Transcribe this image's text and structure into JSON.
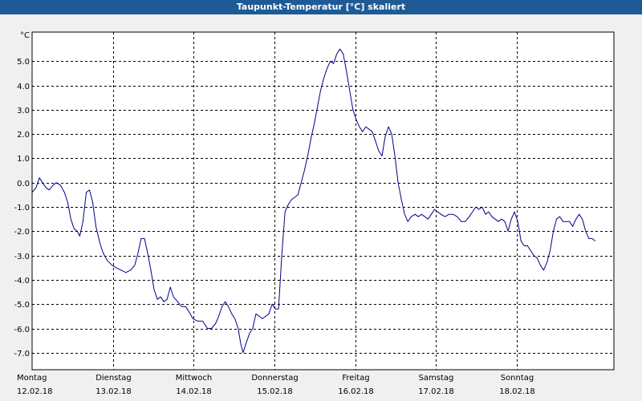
{
  "window": {
    "title": "Taupunkt-Temperatur [°C] skaliert"
  },
  "chart_data": {
    "type": "line",
    "title": "Taupunkt-Temperatur [°C] skaliert",
    "y_unit": "°C",
    "ylim": [
      -7.7,
      6.2
    ],
    "xlim": [
      0,
      7.2
    ],
    "y_ticks": [
      5.0,
      4.0,
      3.0,
      2.0,
      1.0,
      0.0,
      -1.0,
      -2.0,
      -3.0,
      -4.0,
      -5.0,
      -6.0,
      -7.0
    ],
    "y_tick_labels": [
      "5.0",
      "4.0",
      "3.0",
      "2.0",
      "1.0",
      "0.0",
      "-1.0",
      "-2.0",
      "-3.0",
      "-4.0",
      "-5.0",
      "-6.0",
      "-7.0"
    ],
    "x_ticks": [
      {
        "day": "Montag",
        "date": "12.02.18"
      },
      {
        "day": "Dienstag",
        "date": "13.02.18"
      },
      {
        "day": "Mittwoch",
        "date": "14.02.18"
      },
      {
        "day": "Donnerstag",
        "date": "15.02.18"
      },
      {
        "day": "Freitag",
        "date": "16.02.18"
      },
      {
        "day": "Samstag",
        "date": "17.02.18"
      },
      {
        "day": "Sonntag",
        "date": "18.02.18"
      }
    ],
    "grid": true,
    "line_color": "#00008b",
    "series": [
      {
        "points": [
          [
            0.0,
            -0.4
          ],
          [
            0.05,
            -0.2
          ],
          [
            0.09,
            0.2
          ],
          [
            0.13,
            0.0
          ],
          [
            0.17,
            -0.2
          ],
          [
            0.21,
            -0.3
          ],
          [
            0.26,
            -0.1
          ],
          [
            0.3,
            0.0
          ],
          [
            0.35,
            -0.1
          ],
          [
            0.4,
            -0.4
          ],
          [
            0.44,
            -0.8
          ],
          [
            0.48,
            -1.5
          ],
          [
            0.52,
            -1.9
          ],
          [
            0.56,
            -2.0
          ],
          [
            0.59,
            -2.2
          ],
          [
            0.63,
            -1.6
          ],
          [
            0.67,
            -0.4
          ],
          [
            0.71,
            -0.3
          ],
          [
            0.75,
            -0.8
          ],
          [
            0.79,
            -1.8
          ],
          [
            0.84,
            -2.5
          ],
          [
            0.88,
            -2.9
          ],
          [
            0.93,
            -3.2
          ],
          [
            0.99,
            -3.4
          ],
          [
            1.04,
            -3.5
          ],
          [
            1.1,
            -3.6
          ],
          [
            1.16,
            -3.7
          ],
          [
            1.22,
            -3.6
          ],
          [
            1.27,
            -3.4
          ],
          [
            1.31,
            -2.9
          ],
          [
            1.35,
            -2.3
          ],
          [
            1.39,
            -2.3
          ],
          [
            1.43,
            -2.9
          ],
          [
            1.47,
            -3.6
          ],
          [
            1.51,
            -4.4
          ],
          [
            1.55,
            -4.8
          ],
          [
            1.59,
            -4.7
          ],
          [
            1.63,
            -4.9
          ],
          [
            1.67,
            -4.8
          ],
          [
            1.71,
            -4.3
          ],
          [
            1.75,
            -4.7
          ],
          [
            1.8,
            -4.9
          ],
          [
            1.85,
            -5.1
          ],
          [
            1.9,
            -5.1
          ],
          [
            1.94,
            -5.3
          ],
          [
            1.99,
            -5.6
          ],
          [
            2.05,
            -5.7
          ],
          [
            2.11,
            -5.7
          ],
          [
            2.17,
            -6.0
          ],
          [
            2.22,
            -6.0
          ],
          [
            2.27,
            -5.8
          ],
          [
            2.31,
            -5.5
          ],
          [
            2.35,
            -5.1
          ],
          [
            2.39,
            -4.9
          ],
          [
            2.43,
            -5.1
          ],
          [
            2.47,
            -5.4
          ],
          [
            2.51,
            -5.6
          ],
          [
            2.55,
            -6.0
          ],
          [
            2.58,
            -6.6
          ],
          [
            2.61,
            -7.0
          ],
          [
            2.65,
            -6.6
          ],
          [
            2.69,
            -6.2
          ],
          [
            2.73,
            -6.0
          ],
          [
            2.77,
            -5.4
          ],
          [
            2.81,
            -5.5
          ],
          [
            2.85,
            -5.6
          ],
          [
            2.89,
            -5.5
          ],
          [
            2.93,
            -5.4
          ],
          [
            2.97,
            -5.0
          ],
          [
            3.01,
            -5.2
          ],
          [
            3.05,
            -5.2
          ],
          [
            3.09,
            -3.0
          ],
          [
            3.13,
            -1.2
          ],
          [
            3.17,
            -0.9
          ],
          [
            3.21,
            -0.7
          ],
          [
            3.25,
            -0.6
          ],
          [
            3.29,
            -0.5
          ],
          [
            3.33,
            0.0
          ],
          [
            3.37,
            0.5
          ],
          [
            3.41,
            1.1
          ],
          [
            3.45,
            1.8
          ],
          [
            3.49,
            2.4
          ],
          [
            3.53,
            3.1
          ],
          [
            3.57,
            3.8
          ],
          [
            3.61,
            4.3
          ],
          [
            3.65,
            4.7
          ],
          [
            3.69,
            5.0
          ],
          [
            3.73,
            4.9
          ],
          [
            3.77,
            5.3
          ],
          [
            3.81,
            5.5
          ],
          [
            3.85,
            5.3
          ],
          [
            3.89,
            4.6
          ],
          [
            3.93,
            3.8
          ],
          [
            3.97,
            3.0
          ],
          [
            4.01,
            2.6
          ],
          [
            4.05,
            2.3
          ],
          [
            4.09,
            2.1
          ],
          [
            4.13,
            2.3
          ],
          [
            4.17,
            2.2
          ],
          [
            4.21,
            2.1
          ],
          [
            4.25,
            1.7
          ],
          [
            4.29,
            1.3
          ],
          [
            4.33,
            1.1
          ],
          [
            4.37,
            1.9
          ],
          [
            4.41,
            2.3
          ],
          [
            4.45,
            2.0
          ],
          [
            4.49,
            1.1
          ],
          [
            4.53,
            0.0
          ],
          [
            4.57,
            -0.7
          ],
          [
            4.61,
            -1.3
          ],
          [
            4.65,
            -1.6
          ],
          [
            4.69,
            -1.4
          ],
          [
            4.74,
            -1.3
          ],
          [
            4.78,
            -1.4
          ],
          [
            4.82,
            -1.3
          ],
          [
            4.86,
            -1.4
          ],
          [
            4.9,
            -1.5
          ],
          [
            4.94,
            -1.3
          ],
          [
            4.98,
            -1.1
          ],
          [
            5.02,
            -1.2
          ],
          [
            5.06,
            -1.3
          ],
          [
            5.11,
            -1.4
          ],
          [
            5.16,
            -1.3
          ],
          [
            5.21,
            -1.3
          ],
          [
            5.26,
            -1.4
          ],
          [
            5.31,
            -1.6
          ],
          [
            5.36,
            -1.6
          ],
          [
            5.41,
            -1.4
          ],
          [
            5.45,
            -1.2
          ],
          [
            5.49,
            -1.0
          ],
          [
            5.53,
            -1.1
          ],
          [
            5.57,
            -1.0
          ],
          [
            5.61,
            -1.3
          ],
          [
            5.65,
            -1.2
          ],
          [
            5.69,
            -1.4
          ],
          [
            5.73,
            -1.5
          ],
          [
            5.77,
            -1.6
          ],
          [
            5.81,
            -1.5
          ],
          [
            5.85,
            -1.6
          ],
          [
            5.89,
            -2.0
          ],
          [
            5.93,
            -1.5
          ],
          [
            5.97,
            -1.2
          ],
          [
            6.01,
            -1.6
          ],
          [
            6.05,
            -2.4
          ],
          [
            6.09,
            -2.6
          ],
          [
            6.13,
            -2.6
          ],
          [
            6.17,
            -2.8
          ],
          [
            6.21,
            -3.0
          ],
          [
            6.25,
            -3.1
          ],
          [
            6.29,
            -3.4
          ],
          [
            6.33,
            -3.6
          ],
          [
            6.37,
            -3.3
          ],
          [
            6.41,
            -2.8
          ],
          [
            6.45,
            -2.0
          ],
          [
            6.49,
            -1.5
          ],
          [
            6.53,
            -1.4
          ],
          [
            6.57,
            -1.6
          ],
          [
            6.61,
            -1.6
          ],
          [
            6.65,
            -1.6
          ],
          [
            6.69,
            -1.8
          ],
          [
            6.73,
            -1.5
          ],
          [
            6.77,
            -1.3
          ],
          [
            6.81,
            -1.5
          ],
          [
            6.85,
            -2.0
          ],
          [
            6.89,
            -2.3
          ],
          [
            6.93,
            -2.3
          ],
          [
            6.97,
            -2.4
          ]
        ]
      }
    ]
  }
}
